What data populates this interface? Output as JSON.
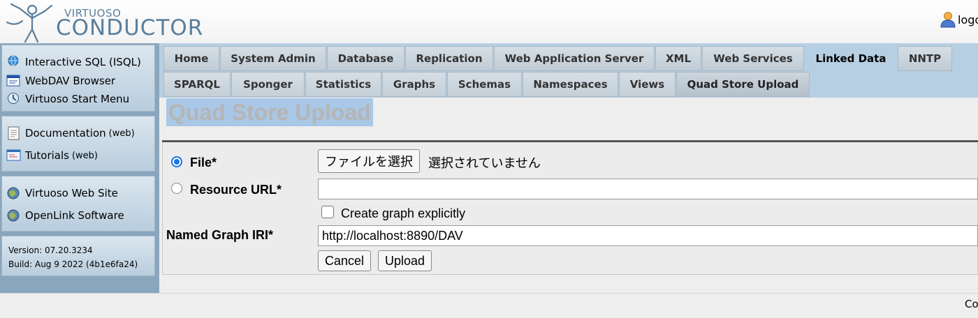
{
  "header": {
    "logo_small": "VIRTUOSO",
    "logo_big": "CONDUCTOR",
    "logout_label": "logo"
  },
  "sidebar": {
    "group1": [
      {
        "label": "Interactive SQL (ISQL)",
        "icon": "isql-icon"
      },
      {
        "label": "WebDAV Browser",
        "icon": "webdav-icon"
      },
      {
        "label": "Virtuoso Start Menu",
        "icon": "start-menu-icon"
      }
    ],
    "group2": [
      {
        "label": "Documentation",
        "suffix": "(web)",
        "icon": "document-icon"
      },
      {
        "label": "Tutorials",
        "suffix": "(web)",
        "icon": "tutorial-icon"
      }
    ],
    "group3": [
      {
        "label": "Virtuoso Web Site",
        "icon": "globe-icon"
      },
      {
        "label": "OpenLink Software",
        "icon": "globe-icon"
      }
    ],
    "version": "Version: 07.20.3234",
    "build": "Build: Aug 9 2022 (4b1e6fa24)"
  },
  "tabs": [
    {
      "label": "Home"
    },
    {
      "label": "System Admin"
    },
    {
      "label": "Database"
    },
    {
      "label": "Replication"
    },
    {
      "label": "Web Application Server"
    },
    {
      "label": "XML"
    },
    {
      "label": "Web Services"
    },
    {
      "label": "Linked Data",
      "active": true
    },
    {
      "label": "NNTP"
    }
  ],
  "subtabs": [
    {
      "label": "SPARQL"
    },
    {
      "label": "Sponger"
    },
    {
      "label": "Statistics"
    },
    {
      "label": "Graphs"
    },
    {
      "label": "Schemas"
    },
    {
      "label": "Namespaces"
    },
    {
      "label": "Views"
    },
    {
      "label": "Quad Store Upload",
      "active": true
    }
  ],
  "page": {
    "title": "Quad Store Upload"
  },
  "form": {
    "file_label": "File*",
    "file_button": "ファイルを選択",
    "file_status": "選択されていません",
    "resource_url_label": "Resource URL*",
    "resource_url_value": "",
    "create_graph_label": "Create graph explicitly",
    "create_graph_checked": false,
    "named_graph_label": "Named Graph IRI*",
    "named_graph_value": "http://localhost:8890/DAV",
    "cancel_label": "Cancel",
    "upload_label": "Upload",
    "selected_source": "file"
  },
  "footer": {
    "text": "Co"
  },
  "colors": {
    "sidebar_bg": "#8aa6bd",
    "tabbar_bg": "#b7cfe2",
    "title_highlight": "#a9c7e6",
    "logo": "#5a7f9c",
    "radio_accent": "#1a73e8"
  }
}
